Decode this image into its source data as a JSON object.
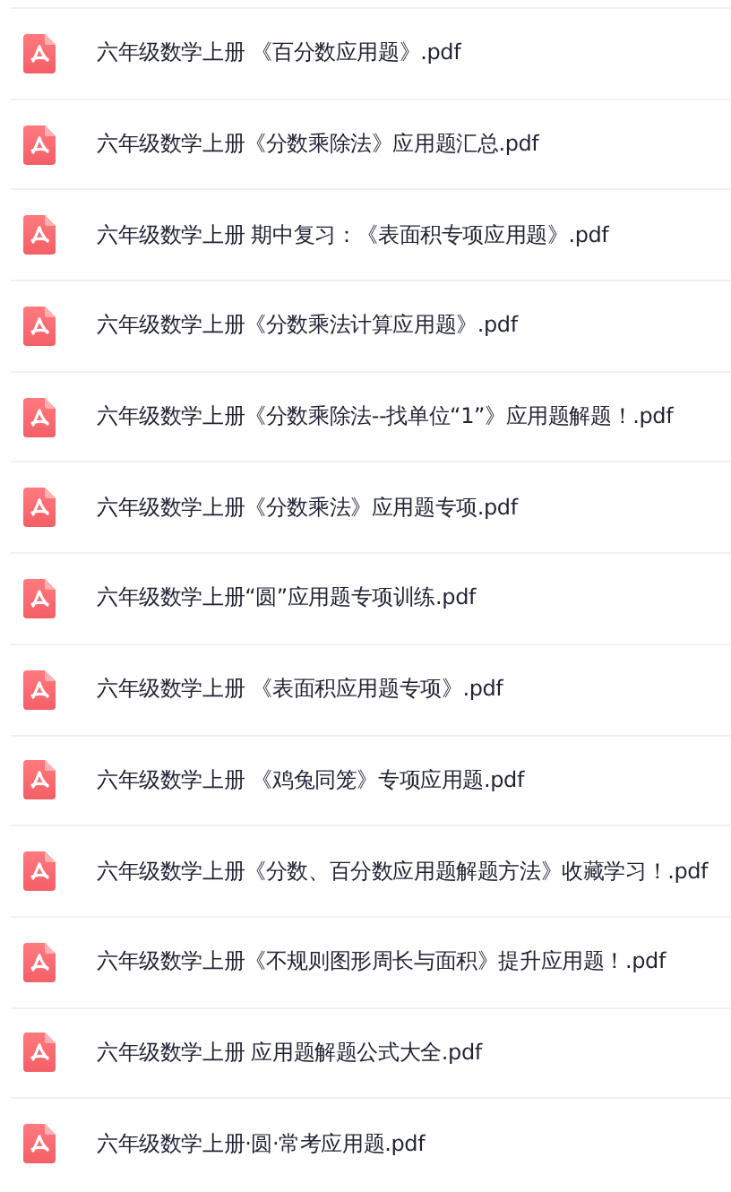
{
  "files": [
    {
      "name": "六年级数学上册 《百分数应用题》.pdf",
      "kind": "pdf"
    },
    {
      "name": "六年级数学上册《分数乘除法》应用题汇总.pdf",
      "kind": "pdf"
    },
    {
      "name": "六年级数学上册 期中复习：《表面积专项应用题》.pdf",
      "kind": "pdf"
    },
    {
      "name": "六年级数学上册《分数乘法计算应用题》.pdf",
      "kind": "pdf"
    },
    {
      "name": "六年级数学上册《分数乘除法--找单位“1”》应用题解题！.pdf",
      "kind": "pdf"
    },
    {
      "name": "六年级数学上册《分数乘法》应用题专项.pdf",
      "kind": "pdf"
    },
    {
      "name": "六年级数学上册“圆”应用题专项训练.pdf",
      "kind": "pdf"
    },
    {
      "name": "六年级数学上册 《表面积应用题专项》.pdf",
      "kind": "pdf"
    },
    {
      "name": "六年级数学上册 《鸡兔同笼》专项应用题.pdf",
      "kind": "pdf"
    },
    {
      "name": "六年级数学上册《分数、百分数应用题解题方法》收藏学习！.pdf",
      "kind": "pdf"
    },
    {
      "name": "六年级数学上册《不规则图形周长与面积》提升应用题！.pdf",
      "kind": "pdf"
    },
    {
      "name": "六年级数学上册 应用题解题公式大全.pdf",
      "kind": "pdf"
    },
    {
      "name": "六年级数学上册·圆·常考应用题.pdf",
      "kind": "pdf"
    }
  ]
}
